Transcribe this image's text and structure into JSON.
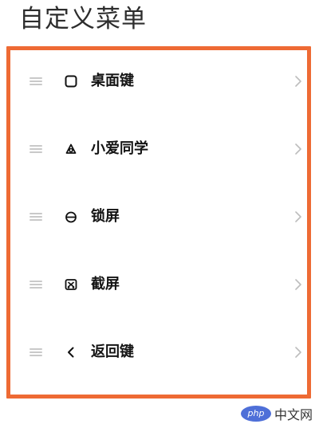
{
  "page": {
    "title": "自定义菜单"
  },
  "menu": {
    "items": [
      {
        "label": "桌面键",
        "icon": "home-square-icon"
      },
      {
        "label": "小爱同学",
        "icon": "assistant-icon"
      },
      {
        "label": "锁屏",
        "icon": "lock-icon"
      },
      {
        "label": "截屏",
        "icon": "screenshot-icon"
      },
      {
        "label": "返回键",
        "icon": "back-arrow-icon"
      }
    ]
  },
  "watermark": {
    "badge": "php",
    "text": "中文网"
  },
  "colors": {
    "frame_border": "#ee6a34",
    "handle": "#c9c9c9",
    "chevron": "#bdbdbd",
    "watermark_badge": "#4e6fd8"
  }
}
